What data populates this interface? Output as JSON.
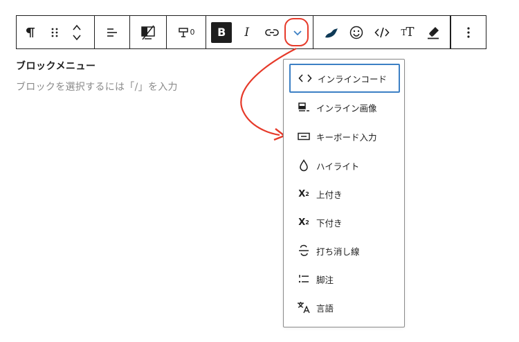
{
  "block": {
    "title": "ブロックメニュー",
    "placeholder": "ブロックを選択するには「/」を入力"
  },
  "toolbar": {
    "highlight_count": "0",
    "bold_label": "B",
    "italic_label": "I",
    "text_size_label": "T",
    "text_size_small_label": "T"
  },
  "menu": {
    "items": [
      {
        "label": "インラインコード",
        "icon": "inline-code-icon",
        "selected": true
      },
      {
        "label": "インライン画像",
        "icon": "inline-image-icon"
      },
      {
        "label": "キーボード入力",
        "icon": "keyboard-icon"
      },
      {
        "label": "ハイライト",
        "icon": "droplet-icon"
      },
      {
        "label": "上付き",
        "icon": "superscript-icon",
        "glyph": "X",
        "mark": "2"
      },
      {
        "label": "下付き",
        "icon": "subscript-icon",
        "glyph": "X",
        "mark": "2"
      },
      {
        "label": "打ち消し線",
        "icon": "strikethrough-icon"
      },
      {
        "label": "脚注",
        "icon": "footnote-icon"
      },
      {
        "label": "言語",
        "icon": "language-icon"
      }
    ]
  },
  "colors": {
    "accent_red": "#e63a2a",
    "focus_blue": "#3b7fc4",
    "text": "#1e1e1e",
    "placeholder": "#8a8a8a"
  }
}
